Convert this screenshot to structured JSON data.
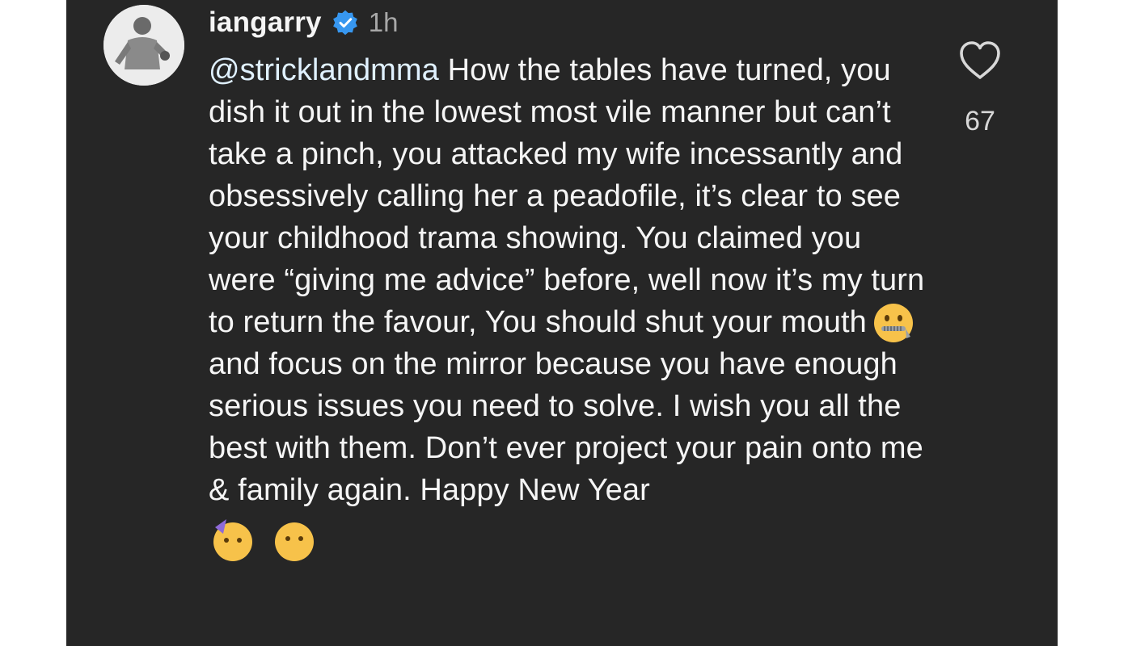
{
  "comment": {
    "username": "iangarry",
    "verified_icon": "verified-badge-icon",
    "time": "1h",
    "mention": "@stricklandmma",
    "text_part1": " How the tables have turned, you dish it out in the lowest most vile manner but can’t take a pinch, you attacked my wife incessantly and obsessively calling her a peadofile, it’s clear to see your childhood trama showing. You claimed you were “giving me advice” before, well now it’s my turn to return the favour, You should shut your mouth",
    "emoji_1": "zipper-mouth-face-emoji",
    "text_part2": " and focus on the mirror because you have enough serious issues you need to solve. I wish you all the best with them. Don’t ever project your pain onto me & family again. Happy New Year",
    "trailing_emojis": [
      "partying-face-emoji",
      "smiley-face-emoji"
    ]
  },
  "like": {
    "icon": "heart-icon",
    "count": "67"
  },
  "colors": {
    "background": "#262626",
    "text": "#f5f5f5",
    "muted": "#a8a8a8",
    "verified": "#3797f0"
  }
}
